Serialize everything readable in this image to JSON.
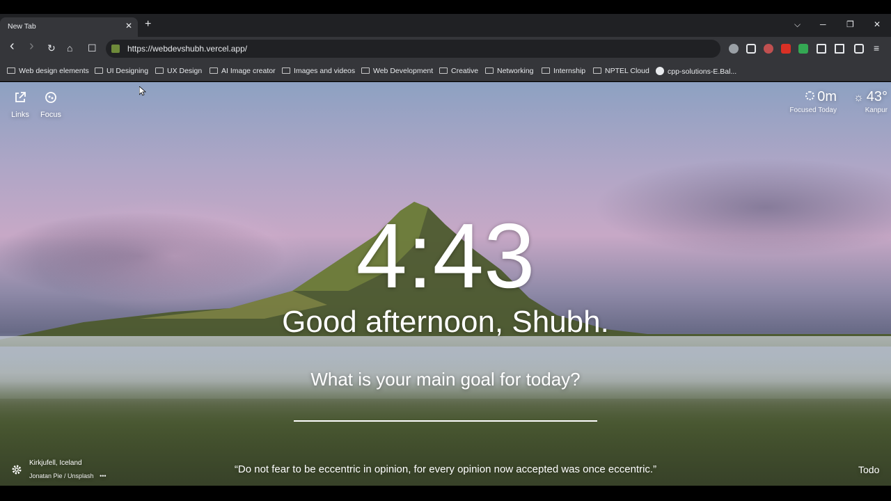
{
  "tab": {
    "title": "New Tab",
    "close": "✕",
    "new_tab": "+"
  },
  "window_controls": {
    "dropdown": "⌵",
    "minimize": "─",
    "restore": "❐",
    "close": "✕"
  },
  "nav": {
    "back": "‹",
    "forward": "›",
    "reload": "↻",
    "home": "⌂",
    "bookmark": "☐"
  },
  "address": {
    "url": "https://webdevshubh.vercel.app/"
  },
  "bookmarks": [
    {
      "label": "Web design elements",
      "icon": "folder-icon"
    },
    {
      "label": "UI Designing",
      "icon": "folder-icon"
    },
    {
      "label": "UX Design",
      "icon": "folder-icon"
    },
    {
      "label": "AI Image creator",
      "icon": "folder-icon"
    },
    {
      "label": "Images and videos",
      "icon": "folder-icon"
    },
    {
      "label": "Web Development",
      "icon": "folder-icon"
    },
    {
      "label": "Creative",
      "icon": "folder-icon"
    },
    {
      "label": "Networking",
      "icon": "folder-icon"
    },
    {
      "label": "Internship",
      "icon": "folder-icon"
    },
    {
      "label": "NPTEL Cloud",
      "icon": "folder-icon"
    },
    {
      "label": "cpp-solutions-E.Bal...",
      "icon": "github-icon"
    }
  ],
  "page": {
    "links_label": "Links",
    "focus_label": "Focus",
    "focus_time": "0m",
    "focus_caption": "Focused Today",
    "temperature": "43°",
    "location": "Kanpur",
    "clock": "4:43",
    "greeting": "Good afternoon, Shubh.",
    "question": "What is your main goal for today?",
    "goal_value": "",
    "quote": "“Do not fear to be eccentric in opinion, for every opinion now accepted was once eccentric.”",
    "photo_location": "Kirkjufell, Iceland",
    "photo_credit": "Jonatan Pie / Unsplash",
    "more": "•••",
    "todo": "Todo"
  }
}
